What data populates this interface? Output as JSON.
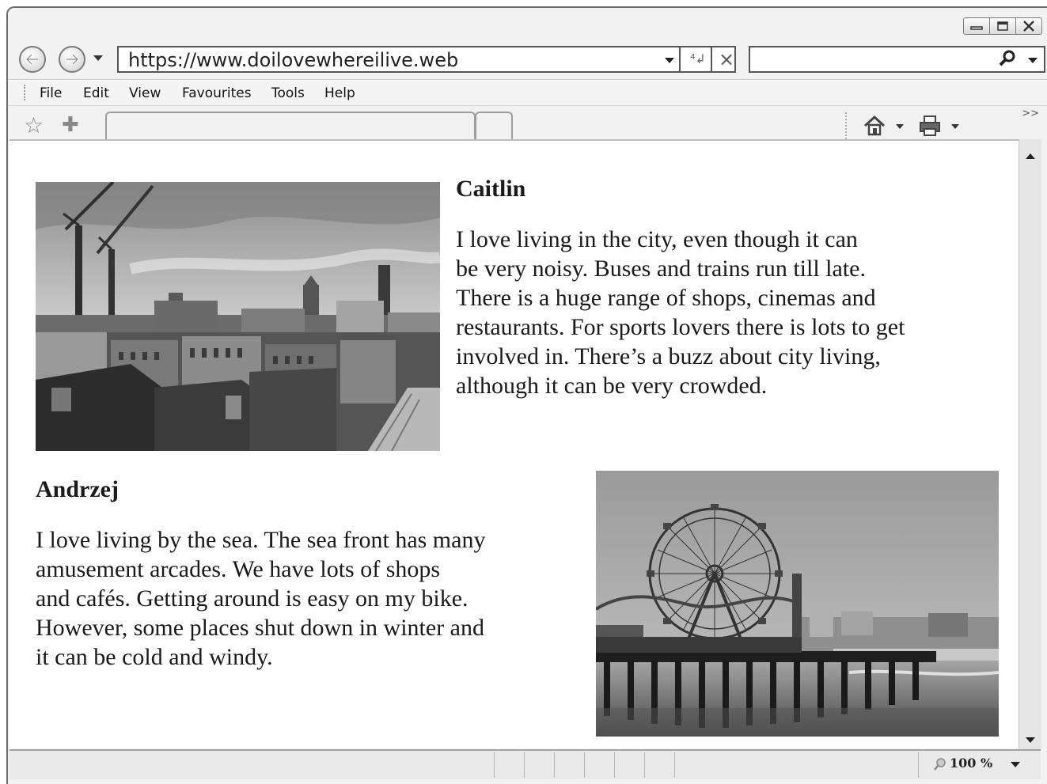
{
  "browser": {
    "url": "https://www.doilovewhereilive.web",
    "menu": [
      "File",
      "Edit",
      "View",
      "Favourites",
      "Tools",
      "Help"
    ],
    "zoom": "100 %",
    "icons": {
      "back": "back-arrow-icon",
      "forward": "forward-arrow-icon",
      "refresh": "refresh-icon",
      "stop": "stop-icon",
      "search": "search-icon",
      "favorites": "star-icon",
      "add_favorite": "add-favorite-icon",
      "home": "home-icon",
      "print": "print-icon"
    }
  },
  "page": {
    "section1": {
      "name": "Caitlin",
      "lines": [
        "I love living in the city, even though it can",
        "be very noisy. Buses and trains run till late.",
        "There is a huge range of shops, cinemas and",
        "restaurants. For sports lovers there is lots to get",
        "involved in. There’s a buzz about city living,",
        "although it can be very crowded."
      ]
    },
    "section2": {
      "name": "Andrzej",
      "lines": [
        "I love living by the sea. The sea front has many",
        "amusement arcades. We have lots of shops",
        "and cafés. Getting around is easy on my bike.",
        "However, some places shut down in winter and",
        "it can be cold and windy."
      ]
    }
  }
}
